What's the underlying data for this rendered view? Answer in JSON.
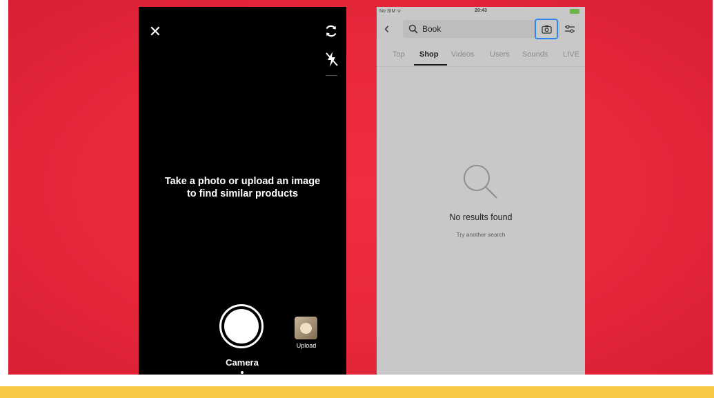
{
  "colors": {
    "background_red": "#e8283b",
    "bottom_bar_yellow": "#f6c944",
    "camera_bg": "#000000",
    "results_bg": "#c8c8c8",
    "highlight_blue": "#2f86ea"
  },
  "camera_screen": {
    "close_icon": "close-icon",
    "flip_icon": "flip-camera-icon",
    "flash_icon": "flash-off-icon",
    "hint_line1": "Take a photo or upload an image",
    "hint_line2": "to find similar products",
    "upload_label": "Upload",
    "camera_label": "Camera"
  },
  "search_screen": {
    "status": {
      "carrier": "No SIM ᯤ",
      "time": "20:43"
    },
    "search_query": "Book",
    "tabs": [
      {
        "label": "Top",
        "active": false
      },
      {
        "label": "Shop",
        "active": true
      },
      {
        "label": "Videos",
        "active": false
      },
      {
        "label": "Users",
        "active": false
      },
      {
        "label": "Sounds",
        "active": false
      },
      {
        "label": "LIVE",
        "active": false
      }
    ],
    "empty_title": "No results found",
    "empty_subtitle": "Try another search"
  }
}
